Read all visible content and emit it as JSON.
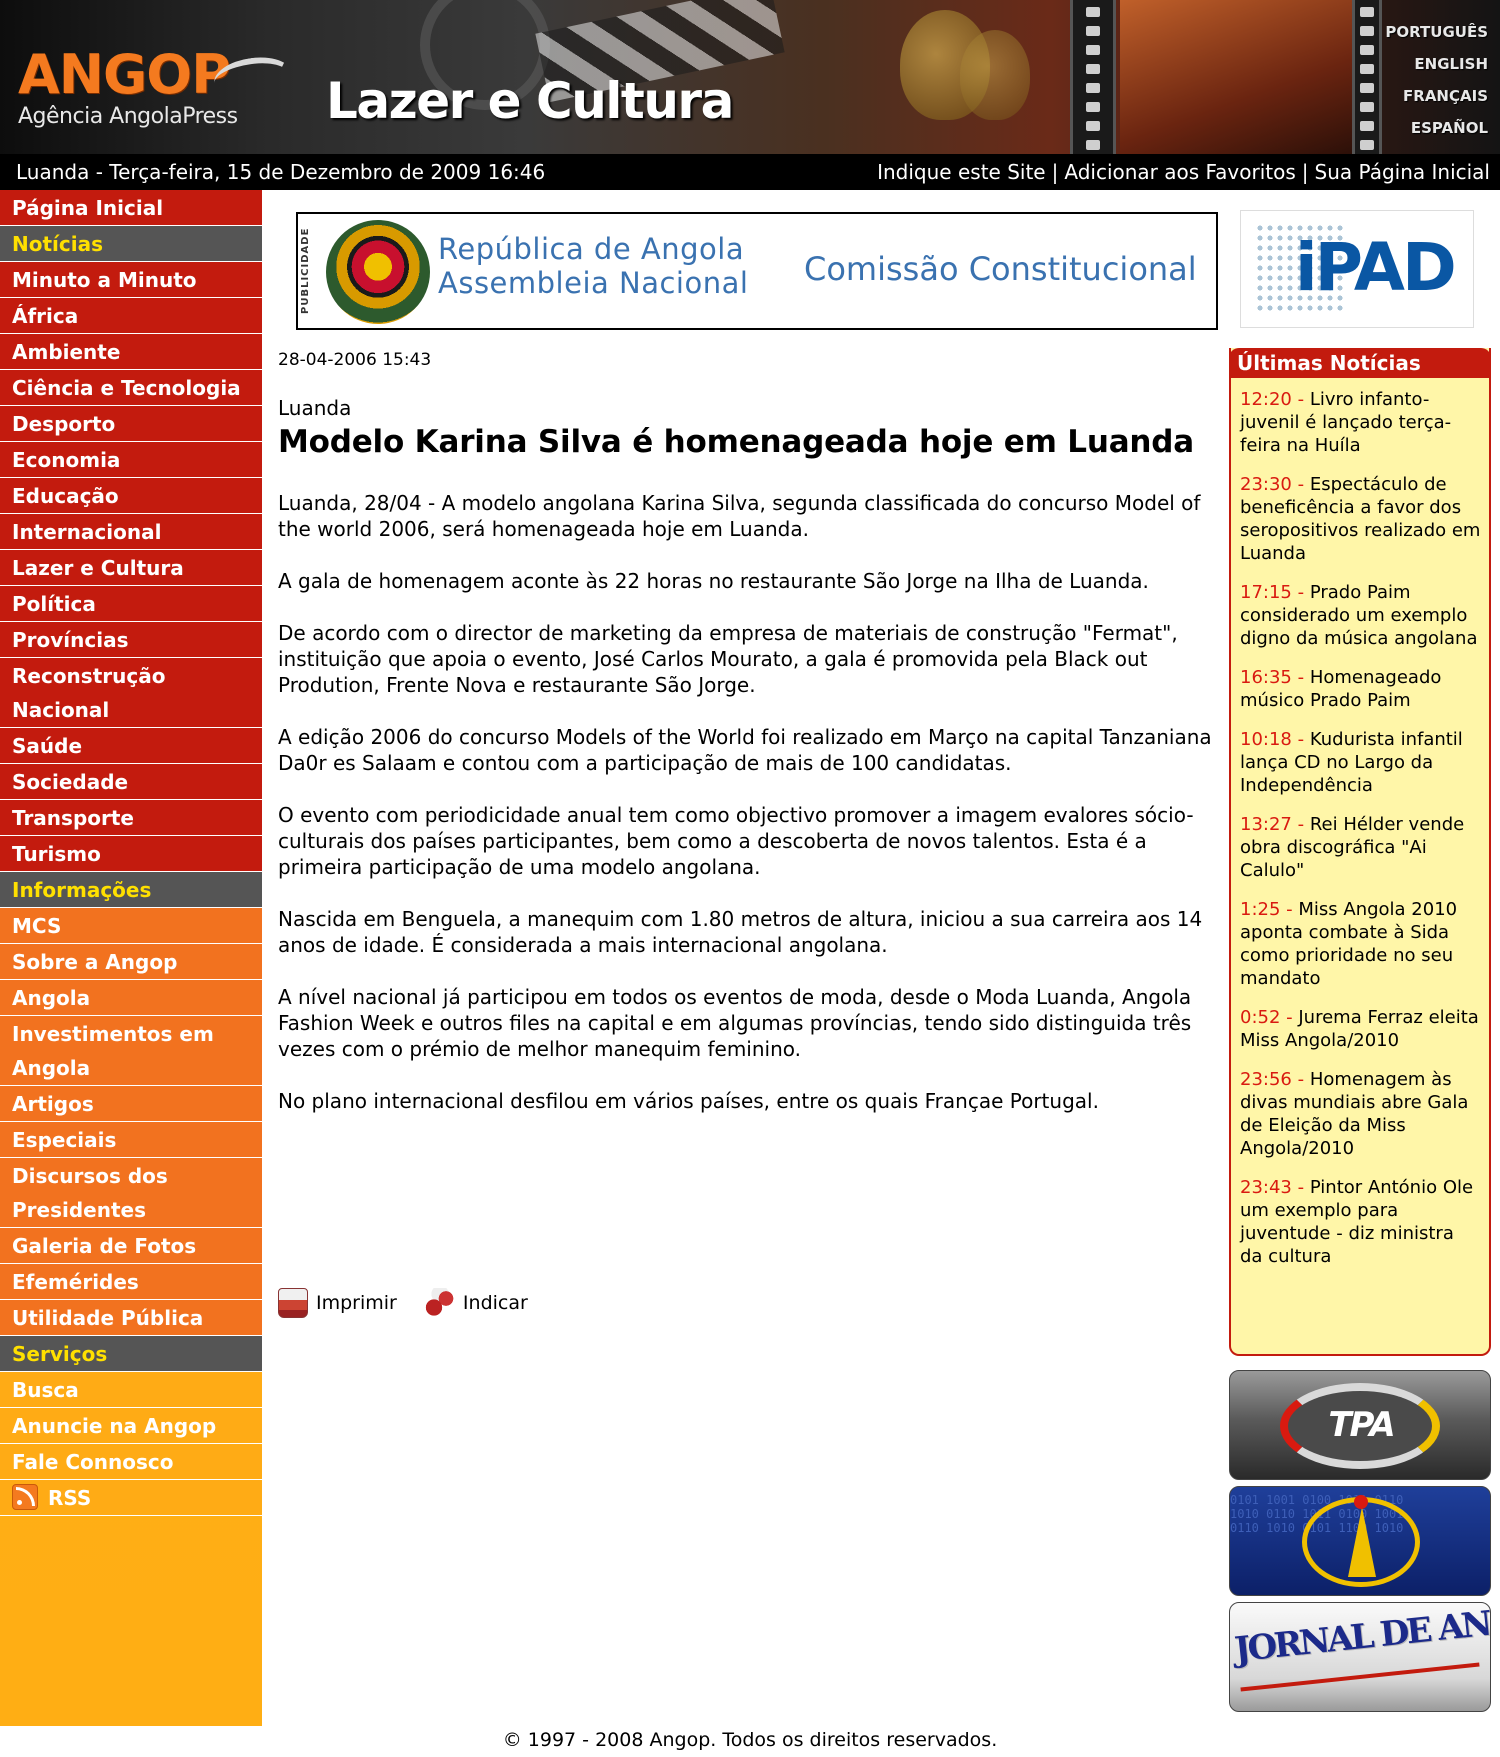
{
  "header": {
    "logo_word": "ANGOP",
    "logo_sub": "Agência AngolaPress",
    "section_title": "Lazer e Cultura",
    "languages": [
      "PORTUGUÊS",
      "ENGLISH",
      "FRANÇAIS",
      "ESPAÑOL"
    ]
  },
  "topbar": {
    "datetime": "Luanda - Terça-feira, 15 de Dezembro de 2009 16:46",
    "links": [
      "Indique este Site",
      "Adicionar aos Favoritos",
      "Sua Página Inicial"
    ],
    "separator": "|"
  },
  "nav": {
    "items": [
      {
        "label": "Página Inicial",
        "style": "red"
      },
      {
        "label": "Notícias",
        "style": "head"
      },
      {
        "label": "Minuto a Minuto",
        "style": "red"
      },
      {
        "label": "África",
        "style": "red"
      },
      {
        "label": "Ambiente",
        "style": "red"
      },
      {
        "label": "Ciência e Tecnologia",
        "style": "red"
      },
      {
        "label": "Desporto",
        "style": "red"
      },
      {
        "label": "Economia",
        "style": "red"
      },
      {
        "label": "Educação",
        "style": "red"
      },
      {
        "label": "Internacional",
        "style": "red"
      },
      {
        "label": "Lazer e Cultura",
        "style": "red"
      },
      {
        "label": "Política",
        "style": "red"
      },
      {
        "label": "Províncias",
        "style": "red"
      },
      {
        "label": "Reconstrução Nacional",
        "style": "red"
      },
      {
        "label": "Saúde",
        "style": "red"
      },
      {
        "label": "Sociedade",
        "style": "red"
      },
      {
        "label": "Transporte",
        "style": "red"
      },
      {
        "label": "Turismo",
        "style": "red"
      },
      {
        "label": "Informações",
        "style": "head"
      },
      {
        "label": "MCS",
        "style": "orange"
      },
      {
        "label": "Sobre a Angop",
        "style": "orange"
      },
      {
        "label": "Angola",
        "style": "orange"
      },
      {
        "label": "Investimentos em Angola",
        "style": "orange"
      },
      {
        "label": "Artigos",
        "style": "orange"
      },
      {
        "label": "Especiais",
        "style": "orange"
      },
      {
        "label": "Discursos dos Presidentes",
        "style": "orange"
      },
      {
        "label": "Galeria de Fotos",
        "style": "orange"
      },
      {
        "label": "Efemérides",
        "style": "orange"
      },
      {
        "label": "Utilidade Pública",
        "style": "orange"
      },
      {
        "label": "Serviços",
        "style": "head"
      },
      {
        "label": "Busca",
        "style": "yellow"
      },
      {
        "label": "Anuncie na Angop",
        "style": "yellow"
      },
      {
        "label": "Fale Connosco",
        "style": "yellow"
      },
      {
        "label": "RSS",
        "style": "yellow",
        "icon": "rss-icon"
      }
    ]
  },
  "ad": {
    "tag": "PUBLICIDADE",
    "line1": "República de Angola",
    "line2": "Assembleia Nacional",
    "line3": "Comissão Constitucional"
  },
  "ipad_ad": {
    "word": "iPAD"
  },
  "article": {
    "date": "28-04-2006 15:43",
    "place": "Luanda",
    "title": "Modelo Karina Silva é homenageada hoje em Luanda",
    "paragraphs": [
      "Luanda, 28/04 - A modelo angolana Karina Silva, segunda classificada do concurso Model of the world 2006, será homenageada hoje em Luanda.",
      "A gala de homenagem aconte às 22 horas no restaurante São Jorge na Ilha de Luanda.",
      "De acordo com o director de marketing da empresa de materiais de construção \"Fermat\", instituição que apoia o evento, José Carlos Mourato, a gala é promovida pela Black out Prodution, Frente Nova e restaurante São Jorge.",
      "A edição 2006 do concurso Models of the World foi realizado em Março na capital Tanzaniana Da0r es Salaam e contou com a participação de mais de 100 candidatas.",
      "O evento com periodicidade anual tem como objectivo promover a imagem evalores sócio-culturais dos países participantes, bem como a descoberta de novos talentos. Esta é a primeira participação de uma modelo angolana.",
      "Nascida em Benguela, a manequim com 1.80 metros de altura, iniciou a sua carreira aos 14 anos de idade. É considerada a mais internacional angolana.",
      "A nível nacional já participou em todos os eventos de moda, desde o Moda Luanda, Angola Fashion Week e outros files na capital e em algumas províncias, tendo sido distinguida três vezes com o prémio de melhor manequim feminino.",
      "No plano internacional desfilou em vários países, entre os quais Françae Portugal."
    ],
    "actions": [
      {
        "label": "Imprimir",
        "icon": "printer-icon"
      },
      {
        "label": "Indicar",
        "icon": "recommend-icon"
      }
    ]
  },
  "news": {
    "heading": "Últimas Notícias",
    "items": [
      {
        "time": "12:20 -",
        "text": "Livro infanto-juvenil é lançado terça-feira na Huíla"
      },
      {
        "time": "23:30 -",
        "text": "Espectáculo de beneficência a favor dos seropositivos realizado em Luanda"
      },
      {
        "time": "17:15 -",
        "text": "Prado Paim considerado um exemplo digno da música angolana"
      },
      {
        "time": "16:35 -",
        "text": "Homenageado músico Prado Paim"
      },
      {
        "time": "10:18 -",
        "text": "Kudurista infantil lança CD no Largo da Independência"
      },
      {
        "time": "13:27 -",
        "text": "Rei Hélder vende obra discográfica \"Ai Calulo\""
      },
      {
        "time": "1:25 -",
        "text": "Miss Angola 2010 aponta combate à Sida como prioridade no seu mandato"
      },
      {
        "time": "0:52 -",
        "text": "Jurema Ferraz eleita Miss Angola/2010"
      },
      {
        "time": "23:56 -",
        "text": "Homenagem às divas mundiais abre Gala de Eleição da Miss Angola/2010"
      },
      {
        "time": "23:43 -",
        "text": "Pintor António Ole um exemplo para juventude - diz ministra da cultura"
      }
    ]
  },
  "media": {
    "tpa_logo": "TPA",
    "radio_bits": "0101 1001 0100 1011 0110\n1010 0110 1011 0100 1001\n0110 1010 0101 1100 1010",
    "jornal_logo": "JORNAL DE ANGOLA"
  },
  "footer": {
    "copyright": "© 1997 - 2008 Angop. Todos os direitos reservados."
  }
}
